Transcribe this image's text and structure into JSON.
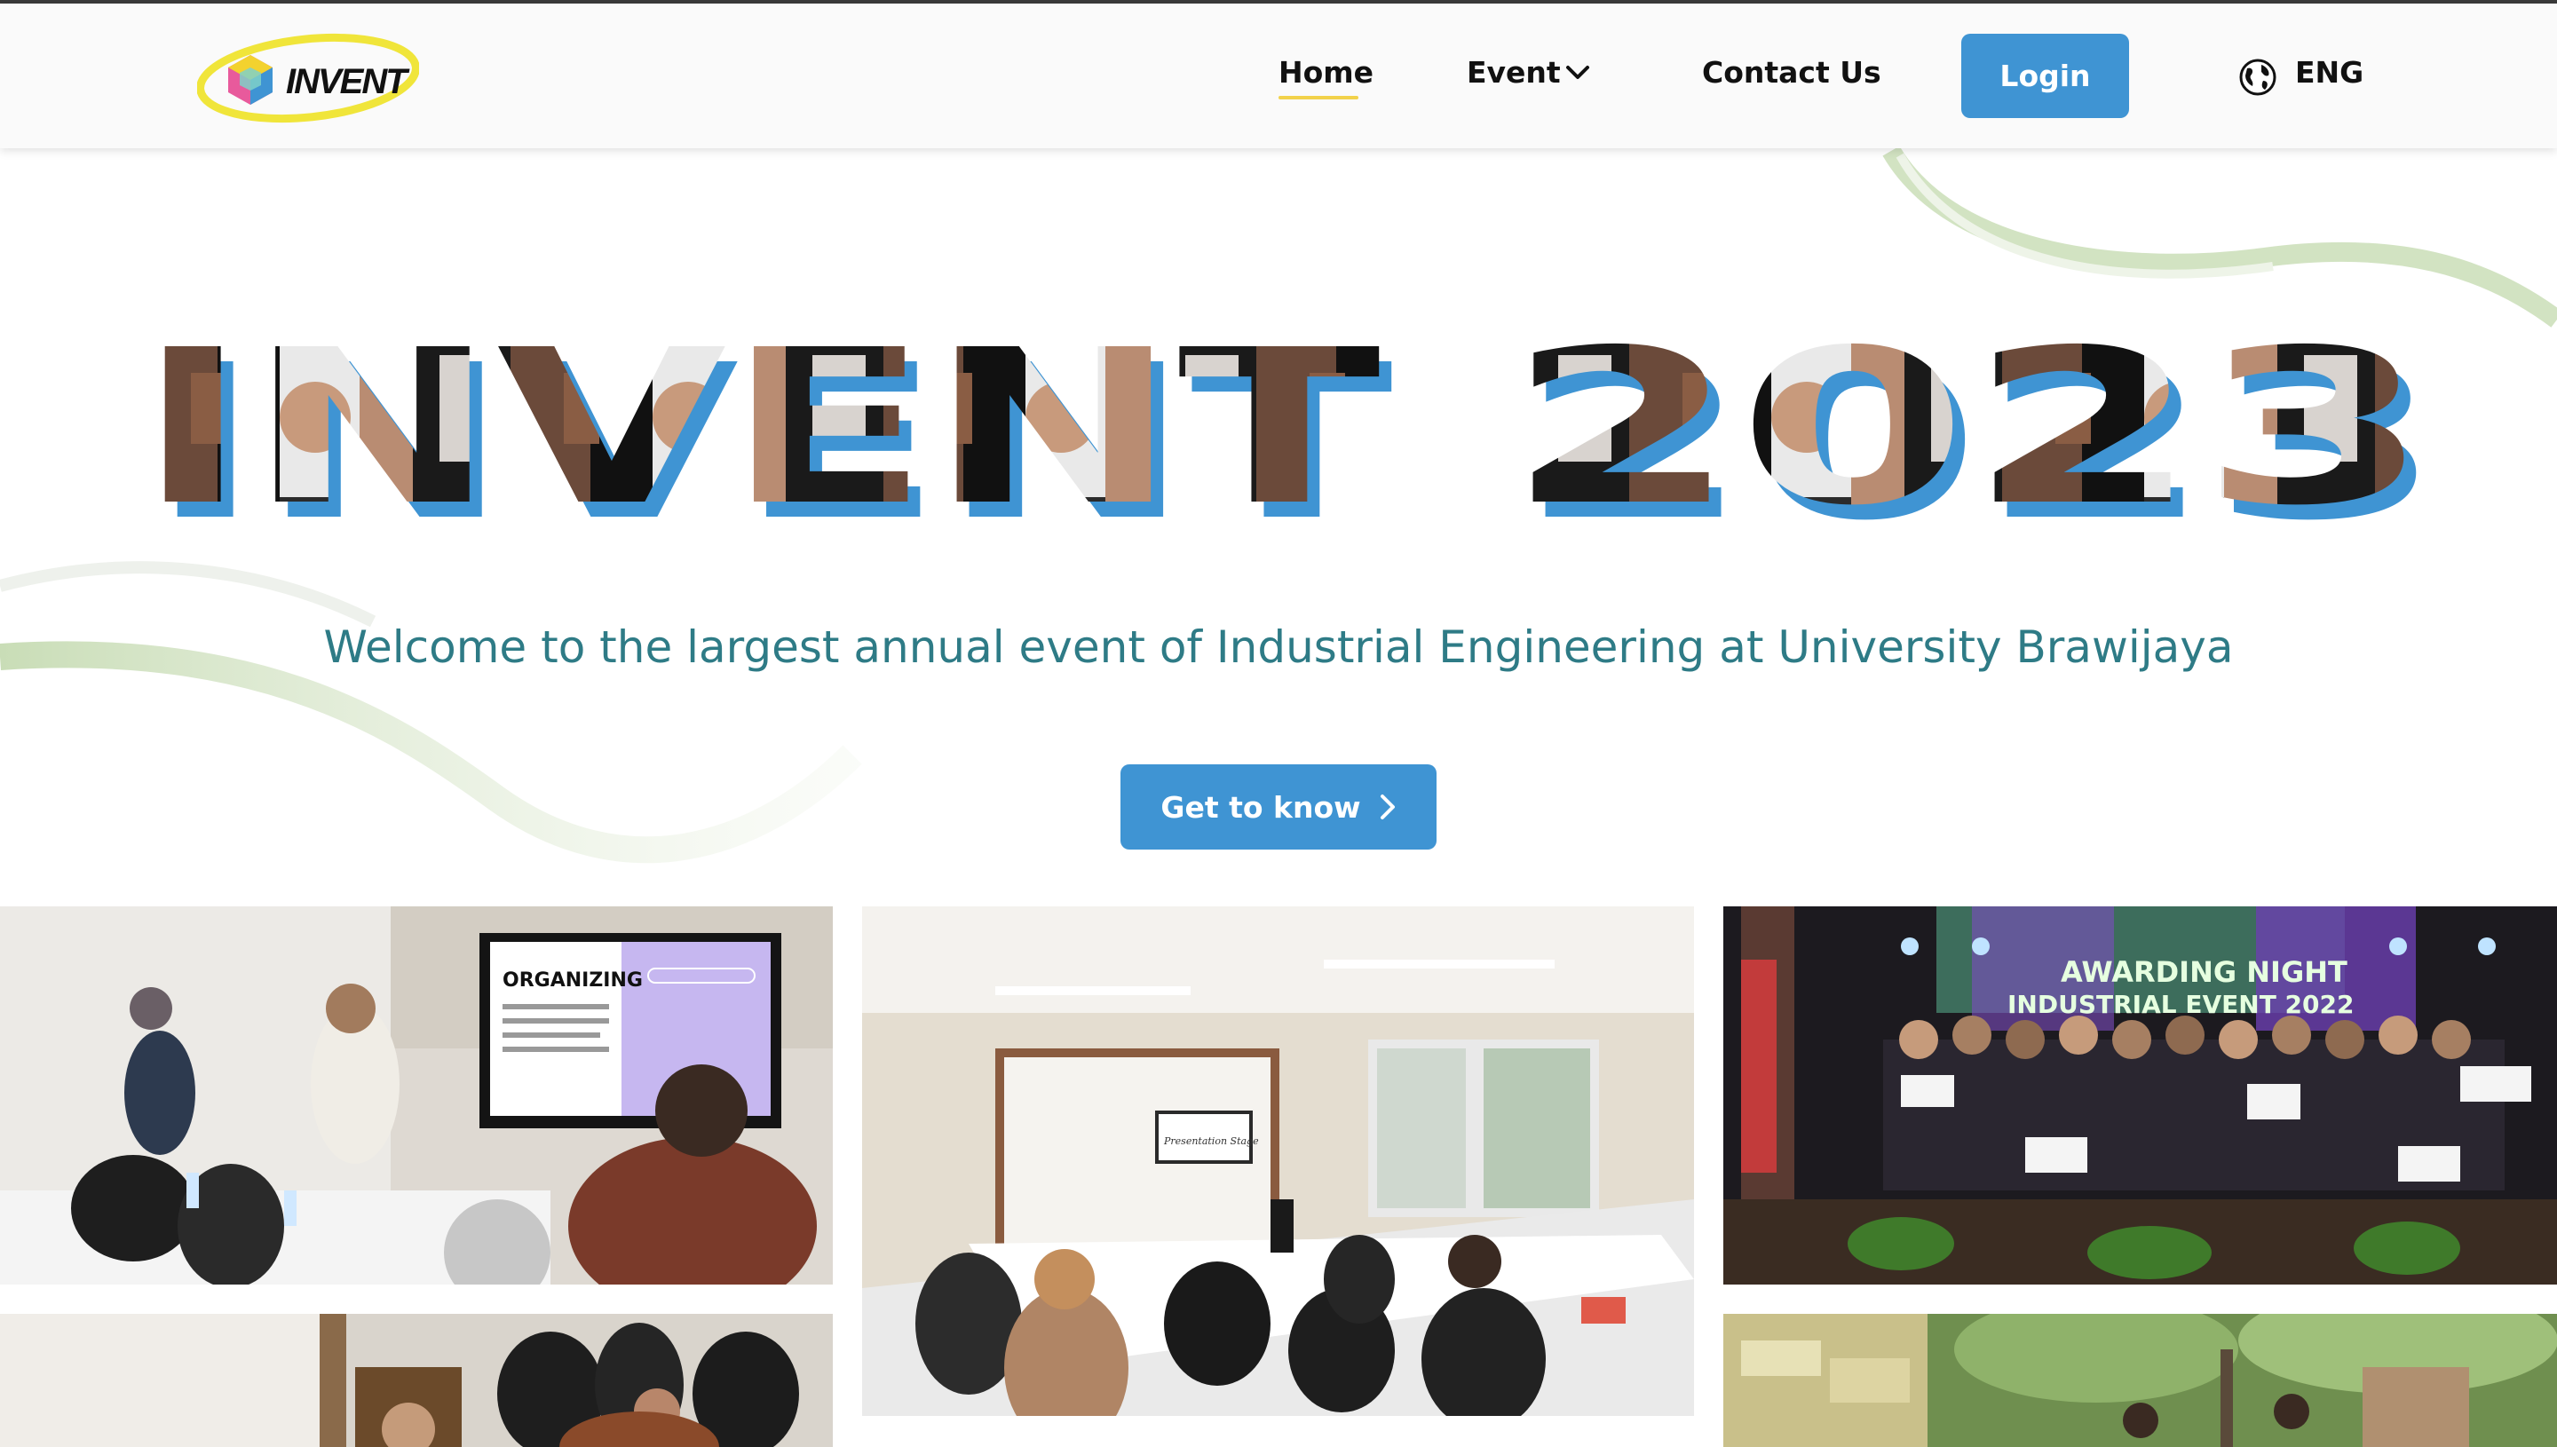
{
  "logo": {
    "text": "INVENT"
  },
  "nav": {
    "home": "Home",
    "event": "Event",
    "contact": "Contact Us",
    "login": "Login",
    "lang": "ENG"
  },
  "hero": {
    "title": "INVENT 2023",
    "subtitle": "Welcome to the largest annual event of Industrial Engineering at University Brawijaya",
    "cta": "Get to know"
  },
  "gallery": {
    "organizing_slide": "ORGANIZING",
    "presentation_slide": "Presentation Stage",
    "awarding_banner_1": "AWARDING NIGHT",
    "awarding_banner_2": "INDUSTRIAL EVENT 2022"
  },
  "colors": {
    "accent_blue": "#3f94d3",
    "teal_text": "#2e7b86",
    "underline_yellow": "#f2d24b",
    "wave_green": "#a9c98c"
  }
}
